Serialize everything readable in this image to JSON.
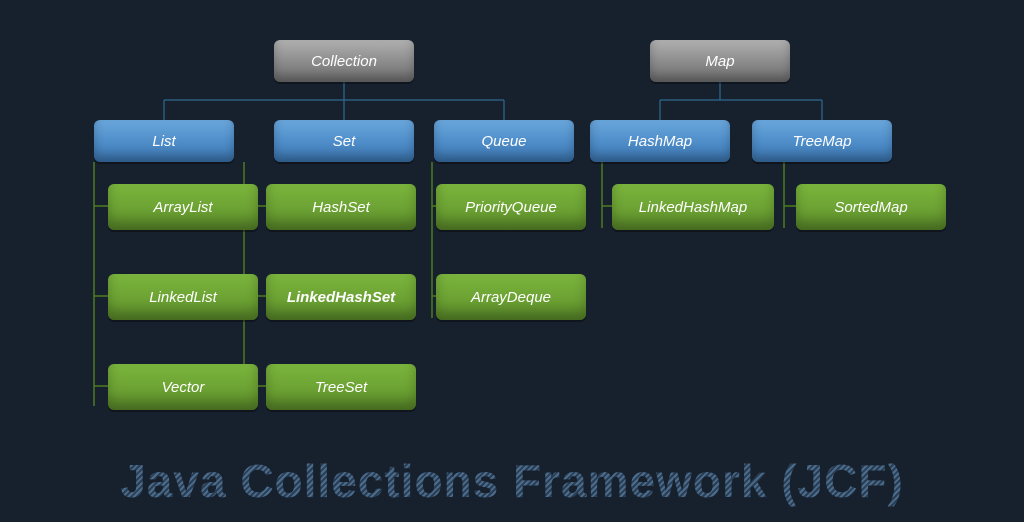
{
  "title": "Java Collections Framework (JCF)",
  "roots": {
    "collection": "Collection",
    "map": "Map"
  },
  "categories": {
    "list": "List",
    "set": "Set",
    "queue": "Queue",
    "hashmap": "HashMap",
    "treemap": "TreeMap"
  },
  "leaves": {
    "arraylist": "ArrayList",
    "linkedlist": "LinkedList",
    "vector": "Vector",
    "hashset": "HashSet",
    "linkedhashset": "LinkedHashSet",
    "treeset": "TreeSet",
    "priorityqueue": "PriorityQueue",
    "arraydeque": "ArrayDeque",
    "linkedhashmap": "LinkedHashMap",
    "sortedmap": "SortedMap"
  }
}
